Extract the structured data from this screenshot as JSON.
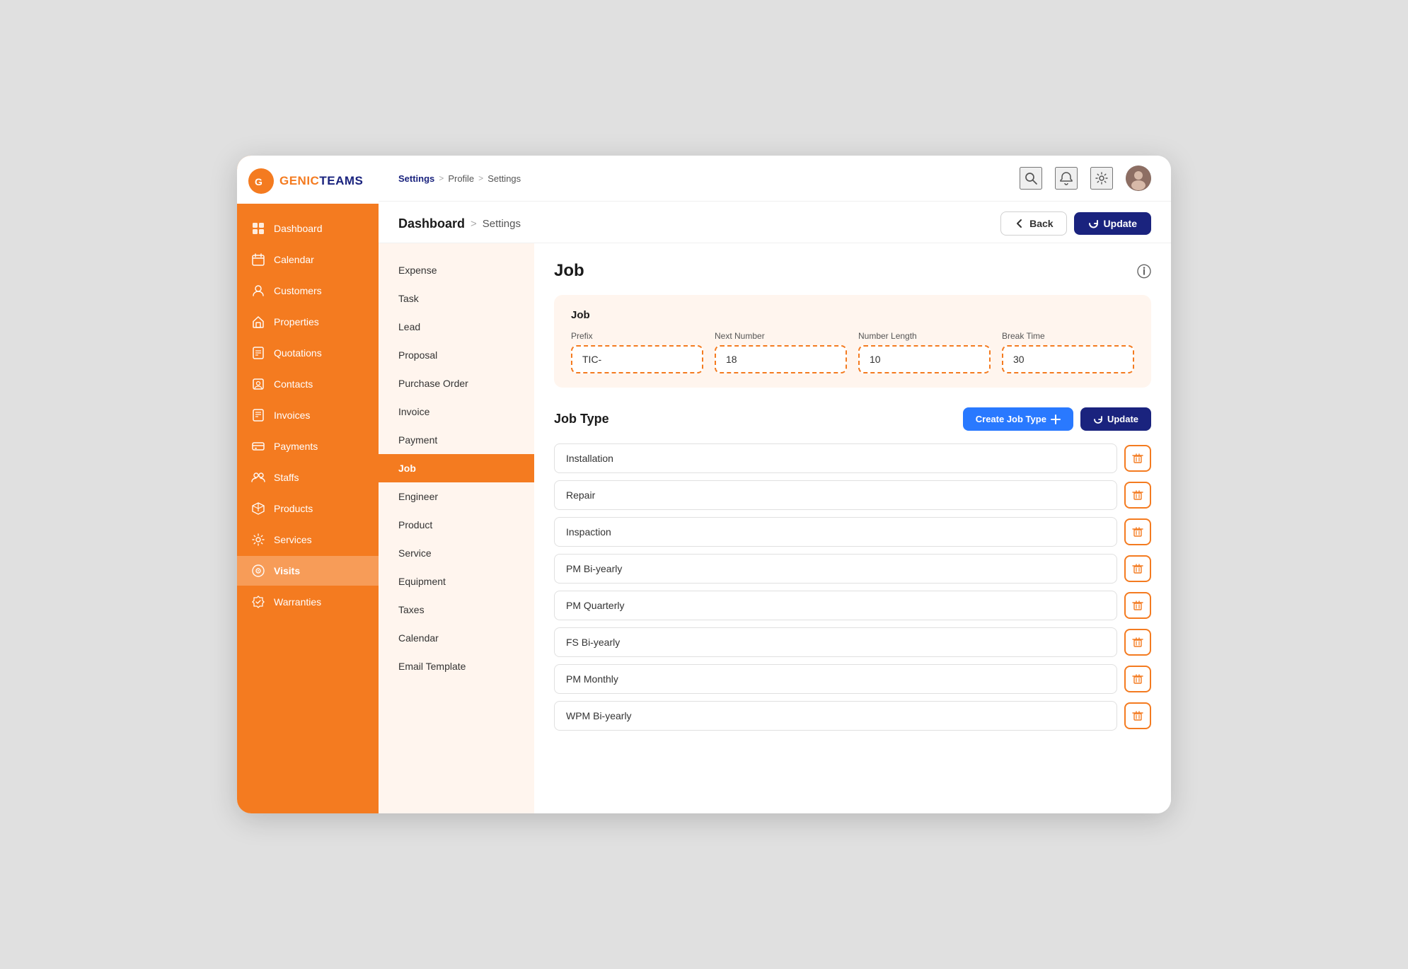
{
  "app": {
    "name_prefix": "GENIC",
    "name_suffix": "TEAMS"
  },
  "top_breadcrumb": {
    "part1": "Settings",
    "sep1": ">",
    "part2": "Profile",
    "sep2": ">",
    "part3": "Settings"
  },
  "page_breadcrumb": {
    "main": "Dashboard",
    "sep": ">",
    "sub": "Settings"
  },
  "buttons": {
    "back": "Back",
    "update_main": "Update",
    "create_job_type": "Create Job Type",
    "update_small": "Update"
  },
  "sidebar_nav": [
    {
      "id": "dashboard",
      "label": "Dashboard"
    },
    {
      "id": "calendar",
      "label": "Calendar"
    },
    {
      "id": "customers",
      "label": "Customers"
    },
    {
      "id": "properties",
      "label": "Properties"
    },
    {
      "id": "quotations",
      "label": "Quotations"
    },
    {
      "id": "contacts",
      "label": "Contacts"
    },
    {
      "id": "invoices",
      "label": "Invoices"
    },
    {
      "id": "payments",
      "label": "Payments"
    },
    {
      "id": "staffs",
      "label": "Staffs"
    },
    {
      "id": "products",
      "label": "Products"
    },
    {
      "id": "services",
      "label": "Services"
    },
    {
      "id": "visits",
      "label": "Visits"
    },
    {
      "id": "warranties",
      "label": "Warranties"
    }
  ],
  "settings_menu": [
    {
      "id": "expense",
      "label": "Expense"
    },
    {
      "id": "task",
      "label": "Task"
    },
    {
      "id": "lead",
      "label": "Lead"
    },
    {
      "id": "proposal",
      "label": "Proposal"
    },
    {
      "id": "purchase_order",
      "label": "Purchase Order"
    },
    {
      "id": "invoice",
      "label": "Invoice"
    },
    {
      "id": "payment",
      "label": "Payment"
    },
    {
      "id": "job",
      "label": "Job",
      "active": true
    },
    {
      "id": "engineer",
      "label": "Engineer"
    },
    {
      "id": "product",
      "label": "Product"
    },
    {
      "id": "service",
      "label": "Service"
    },
    {
      "id": "equipment",
      "label": "Equipment"
    },
    {
      "id": "taxes",
      "label": "Taxes"
    },
    {
      "id": "calendar",
      "label": "Calendar"
    },
    {
      "id": "email_template",
      "label": "Email Template"
    }
  ],
  "page_title": "Job",
  "job_section": {
    "title": "Job",
    "fields": [
      {
        "id": "prefix",
        "label": "Prefix",
        "value": "TIC-"
      },
      {
        "id": "next_number",
        "label": "Next Number",
        "value": "18"
      },
      {
        "id": "number_length",
        "label": "Number Length",
        "value": "10"
      },
      {
        "id": "break_time",
        "label": "Break Time",
        "value": "30"
      }
    ]
  },
  "job_type_section": {
    "title": "Job Type",
    "items": [
      {
        "id": "jt1",
        "value": "Installation"
      },
      {
        "id": "jt2",
        "value": "Repair"
      },
      {
        "id": "jt3",
        "value": "Inspaction"
      },
      {
        "id": "jt4",
        "value": "PM Bi-yearly"
      },
      {
        "id": "jt5",
        "value": "PM Quarterly"
      },
      {
        "id": "jt6",
        "value": "FS Bi-yearly"
      },
      {
        "id": "jt7",
        "value": "PM Monthly"
      },
      {
        "id": "jt8",
        "value": "WPM Bi-yearly"
      }
    ]
  }
}
